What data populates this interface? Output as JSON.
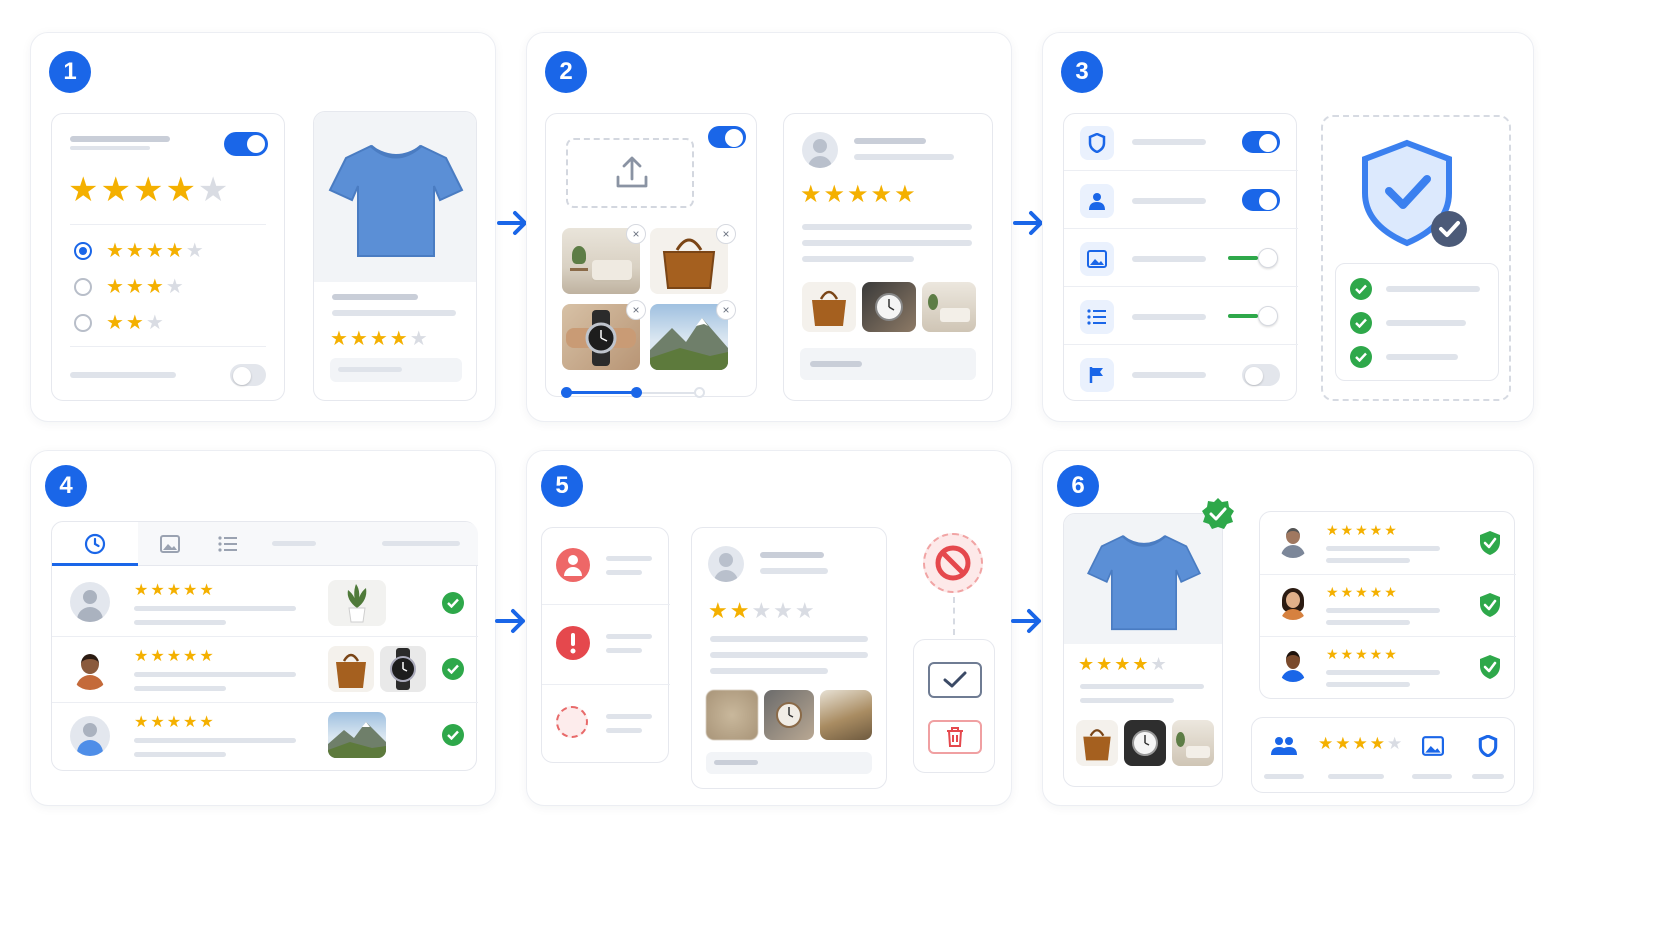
{
  "steps": [
    {
      "number": "1"
    },
    {
      "number": "2"
    },
    {
      "number": "3"
    },
    {
      "number": "4"
    },
    {
      "number": "5"
    },
    {
      "number": "6"
    }
  ],
  "ratings": {
    "five": "★★★★★",
    "four_full": "★★★★",
    "three_full": "★★★",
    "two_full": "★★",
    "empty_one": "★",
    "empty_two": "★★",
    "empty_three": "★★★"
  },
  "glyphs": {
    "close": "×",
    "arrow": "→"
  },
  "colors": {
    "accent": "#1a66e8",
    "star": "#f4b000",
    "success": "#2ea84a",
    "danger": "#e5484d",
    "shirt": "#5b8fd6"
  },
  "icons": [
    "upload-icon",
    "shield-icon",
    "user-icon",
    "image-icon",
    "list-icon",
    "flag-icon",
    "clock-icon",
    "block-icon",
    "checkmark-icon",
    "trash-icon",
    "users-icon",
    "alert-icon"
  ]
}
